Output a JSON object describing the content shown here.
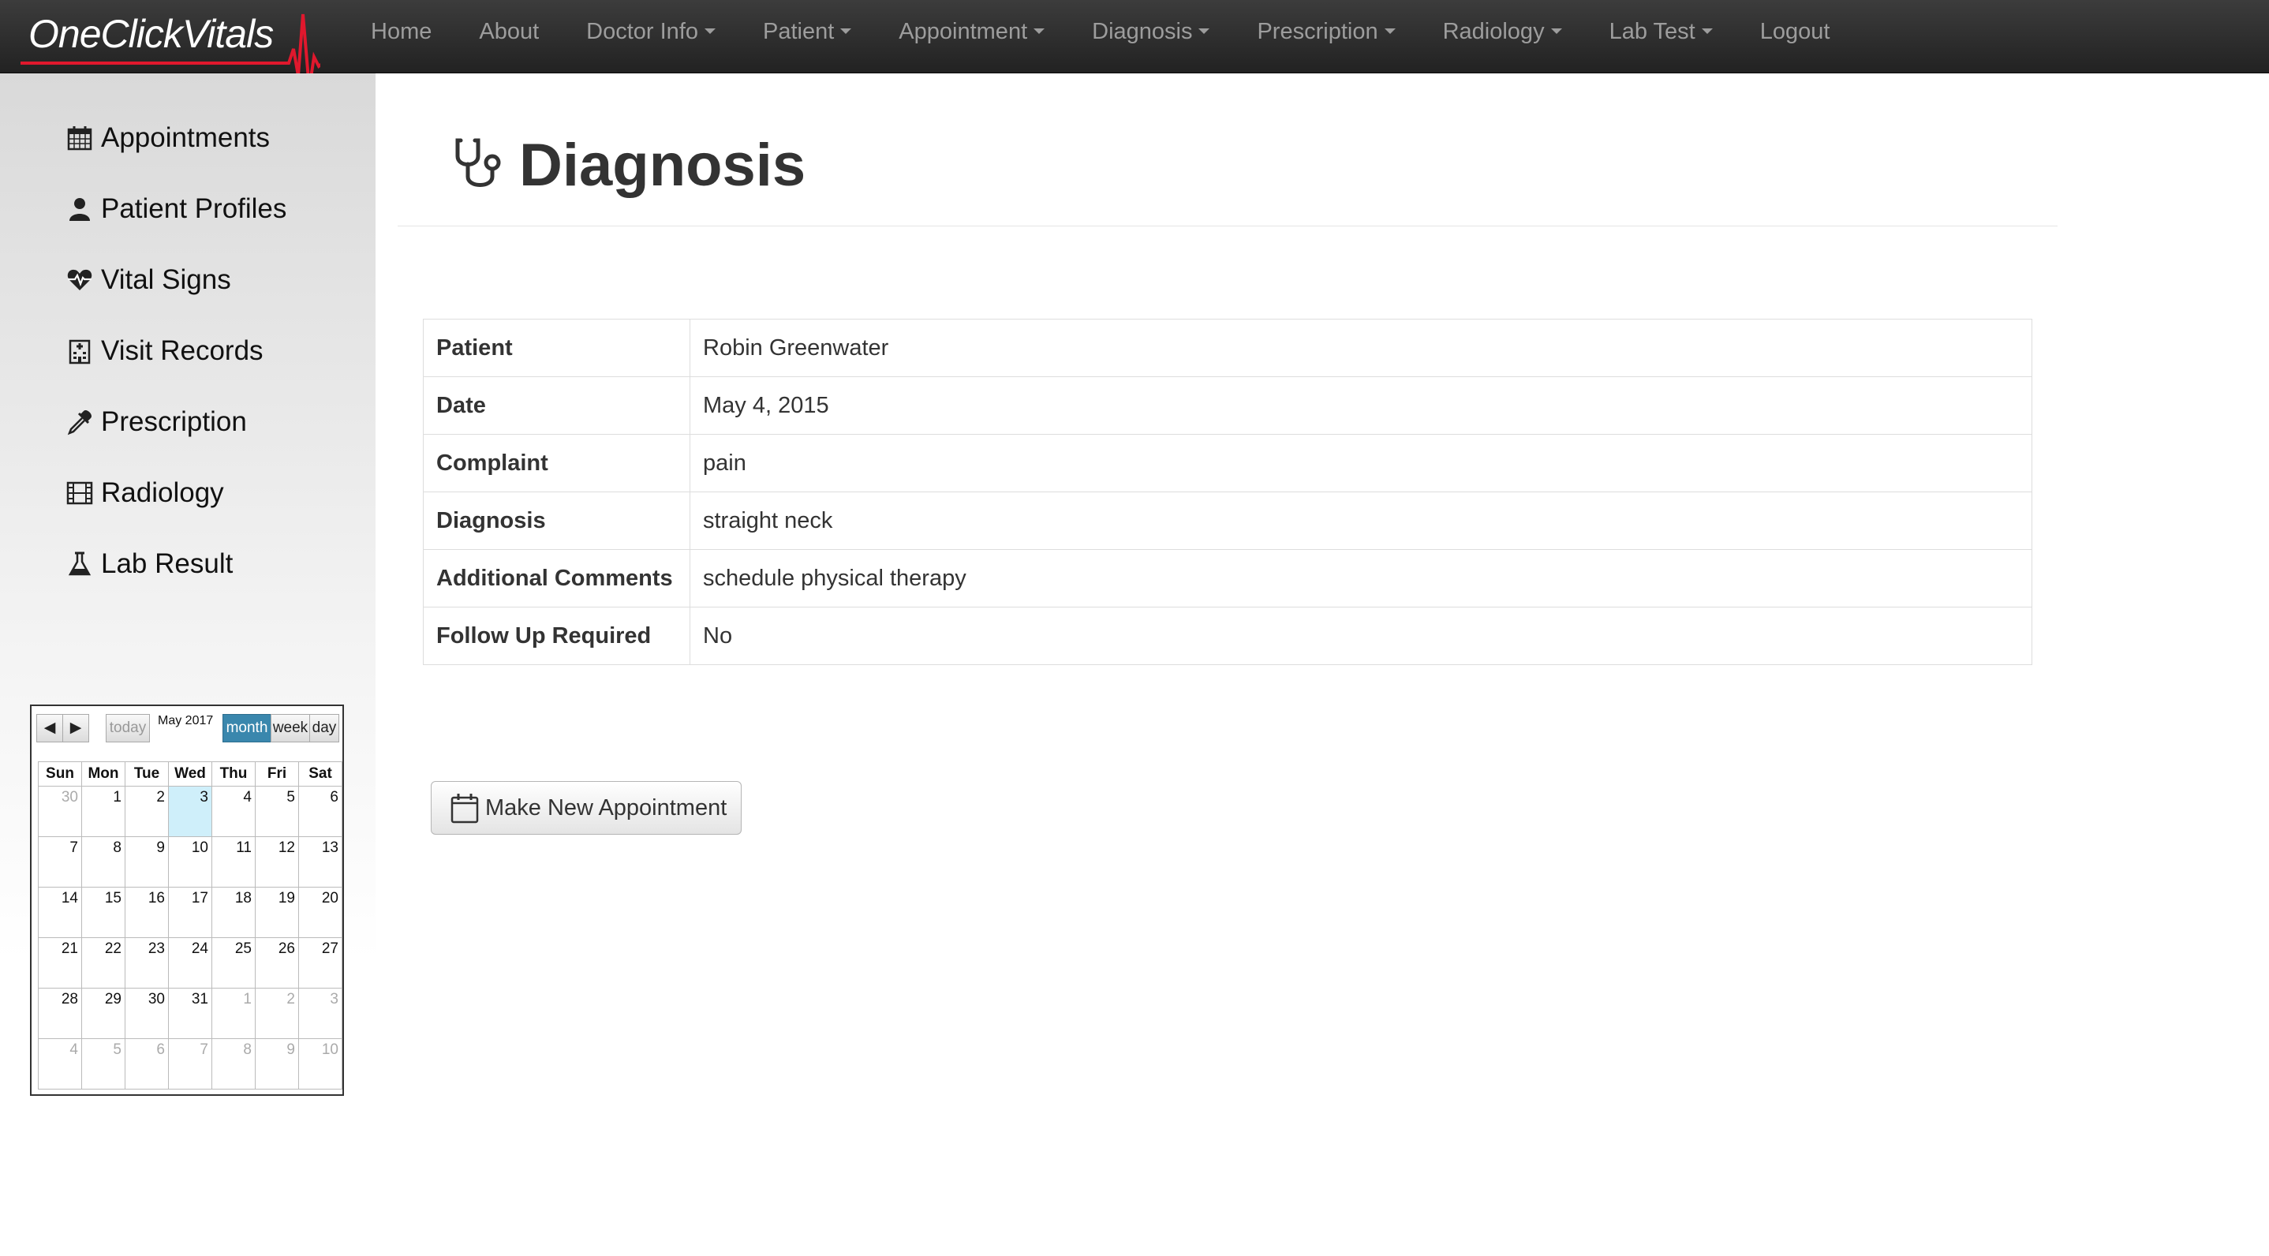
{
  "brand": {
    "name": "OneClickVitals"
  },
  "nav": {
    "items": [
      {
        "label": "Home",
        "dropdown": false
      },
      {
        "label": "About",
        "dropdown": false
      },
      {
        "label": "Doctor Info",
        "dropdown": true
      },
      {
        "label": "Patient",
        "dropdown": true
      },
      {
        "label": "Appointment",
        "dropdown": true
      },
      {
        "label": "Diagnosis",
        "dropdown": true
      },
      {
        "label": "Prescription",
        "dropdown": true
      },
      {
        "label": "Radiology",
        "dropdown": true
      },
      {
        "label": "Lab Test",
        "dropdown": true
      },
      {
        "label": "Logout",
        "dropdown": false
      }
    ]
  },
  "sidebar": {
    "items": [
      {
        "label": "Appointments",
        "icon": "calendar-icon"
      },
      {
        "label": "Patient Profiles",
        "icon": "user-icon"
      },
      {
        "label": "Vital Signs",
        "icon": "heartbeat-icon"
      },
      {
        "label": "Visit Records",
        "icon": "hospital-icon"
      },
      {
        "label": "Prescription",
        "icon": "eyedropper-icon"
      },
      {
        "label": "Radiology",
        "icon": "film-icon"
      },
      {
        "label": "Lab Result",
        "icon": "flask-icon"
      }
    ]
  },
  "calendar": {
    "title": "May 2017",
    "prev": "◀",
    "next": "▶",
    "today_label": "today",
    "views": [
      "month",
      "week",
      "day"
    ],
    "active_view": "month",
    "weekdays": [
      "Sun",
      "Mon",
      "Tue",
      "Wed",
      "Thu",
      "Fri",
      "Sat"
    ],
    "weeks": [
      [
        "30",
        "1",
        "2",
        "3",
        "4",
        "5",
        "6"
      ],
      [
        "7",
        "8",
        "9",
        "10",
        "11",
        "12",
        "13"
      ],
      [
        "14",
        "15",
        "16",
        "17",
        "18",
        "19",
        "20"
      ],
      [
        "21",
        "22",
        "23",
        "24",
        "25",
        "26",
        "27"
      ],
      [
        "28",
        "29",
        "30",
        "31",
        "1",
        "2",
        "3"
      ],
      [
        "4",
        "5",
        "6",
        "7",
        "8",
        "9",
        "10"
      ]
    ],
    "today": "3"
  },
  "page": {
    "title": "Diagnosis",
    "icon": "stethoscope-icon"
  },
  "details": {
    "rows": [
      {
        "label": "Patient",
        "value": "Robin Greenwater"
      },
      {
        "label": "Date",
        "value": "May 4, 2015"
      },
      {
        "label": "Complaint",
        "value": "pain"
      },
      {
        "label": "Diagnosis",
        "value": "straight neck"
      },
      {
        "label": "Additional Comments",
        "value": "schedule physical therapy"
      },
      {
        "label": "Follow Up Required",
        "value": "No"
      }
    ]
  },
  "actions": {
    "new_appointment": "Make New Appointment"
  },
  "colors": {
    "navbar": "#222222",
    "brand_accent": "#e0182d",
    "calendar_active": "#3a87ad",
    "calendar_today": "#cfeffa"
  }
}
